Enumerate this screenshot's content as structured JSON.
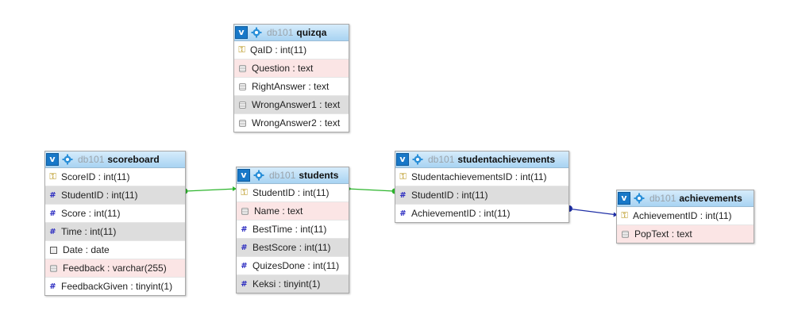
{
  "db_name": "db101",
  "colors": {
    "link_green": "#2db52d",
    "link_blue": "#1f2fa6",
    "header_blue": "#1878c8"
  },
  "tables": {
    "quizqa": {
      "name": "quizqa",
      "columns": [
        {
          "label": "QaID : int(11)",
          "icon": "key-icon",
          "shade": "white"
        },
        {
          "label": "Question : text",
          "icon": "text-icon",
          "shade": "pink"
        },
        {
          "label": "RightAnswer : text",
          "icon": "text-icon",
          "shade": "white"
        },
        {
          "label": "WrongAnswer1 : text",
          "icon": "text-icon",
          "shade": "gray"
        },
        {
          "label": "WrongAnswer2 : text",
          "icon": "text-icon",
          "shade": "white"
        }
      ]
    },
    "scoreboard": {
      "name": "scoreboard",
      "columns": [
        {
          "label": "ScoreID : int(11)",
          "icon": "key-icon",
          "shade": "white"
        },
        {
          "label": "StudentID : int(11)",
          "icon": "number-icon",
          "shade": "gray"
        },
        {
          "label": "Score : int(11)",
          "icon": "number-icon",
          "shade": "white"
        },
        {
          "label": "Time : int(11)",
          "icon": "number-icon",
          "shade": "gray"
        },
        {
          "label": "Date : date",
          "icon": "date-icon",
          "shade": "white"
        },
        {
          "label": "Feedback : varchar(255)",
          "icon": "text-icon",
          "shade": "pink"
        },
        {
          "label": "FeedbackGiven : tinyint(1)",
          "icon": "number-icon",
          "shade": "white"
        }
      ]
    },
    "students": {
      "name": "students",
      "columns": [
        {
          "label": "StudentID : int(11)",
          "icon": "key-icon",
          "shade": "white"
        },
        {
          "label": "Name : text",
          "icon": "text-icon",
          "shade": "pink"
        },
        {
          "label": "BestTime : int(11)",
          "icon": "number-icon",
          "shade": "white"
        },
        {
          "label": "BestScore : int(11)",
          "icon": "number-icon",
          "shade": "gray"
        },
        {
          "label": "QuizesDone : int(11)",
          "icon": "number-icon",
          "shade": "white"
        },
        {
          "label": "Keksi : tinyint(1)",
          "icon": "number-icon",
          "shade": "gray"
        }
      ]
    },
    "studentachievements": {
      "name": "studentachievements",
      "columns": [
        {
          "label": "StudentachievementsID : int(11)",
          "icon": "key-icon",
          "shade": "white"
        },
        {
          "label": "StudentID : int(11)",
          "icon": "number-icon",
          "shade": "gray"
        },
        {
          "label": "AchievementID : int(11)",
          "icon": "number-icon",
          "shade": "white"
        }
      ]
    },
    "achievements": {
      "name": "achievements",
      "columns": [
        {
          "label": "AchievementID : int(11)",
          "icon": "key-icon",
          "shade": "white"
        },
        {
          "label": "PopText : text",
          "icon": "text-icon",
          "shade": "pink"
        }
      ]
    }
  }
}
